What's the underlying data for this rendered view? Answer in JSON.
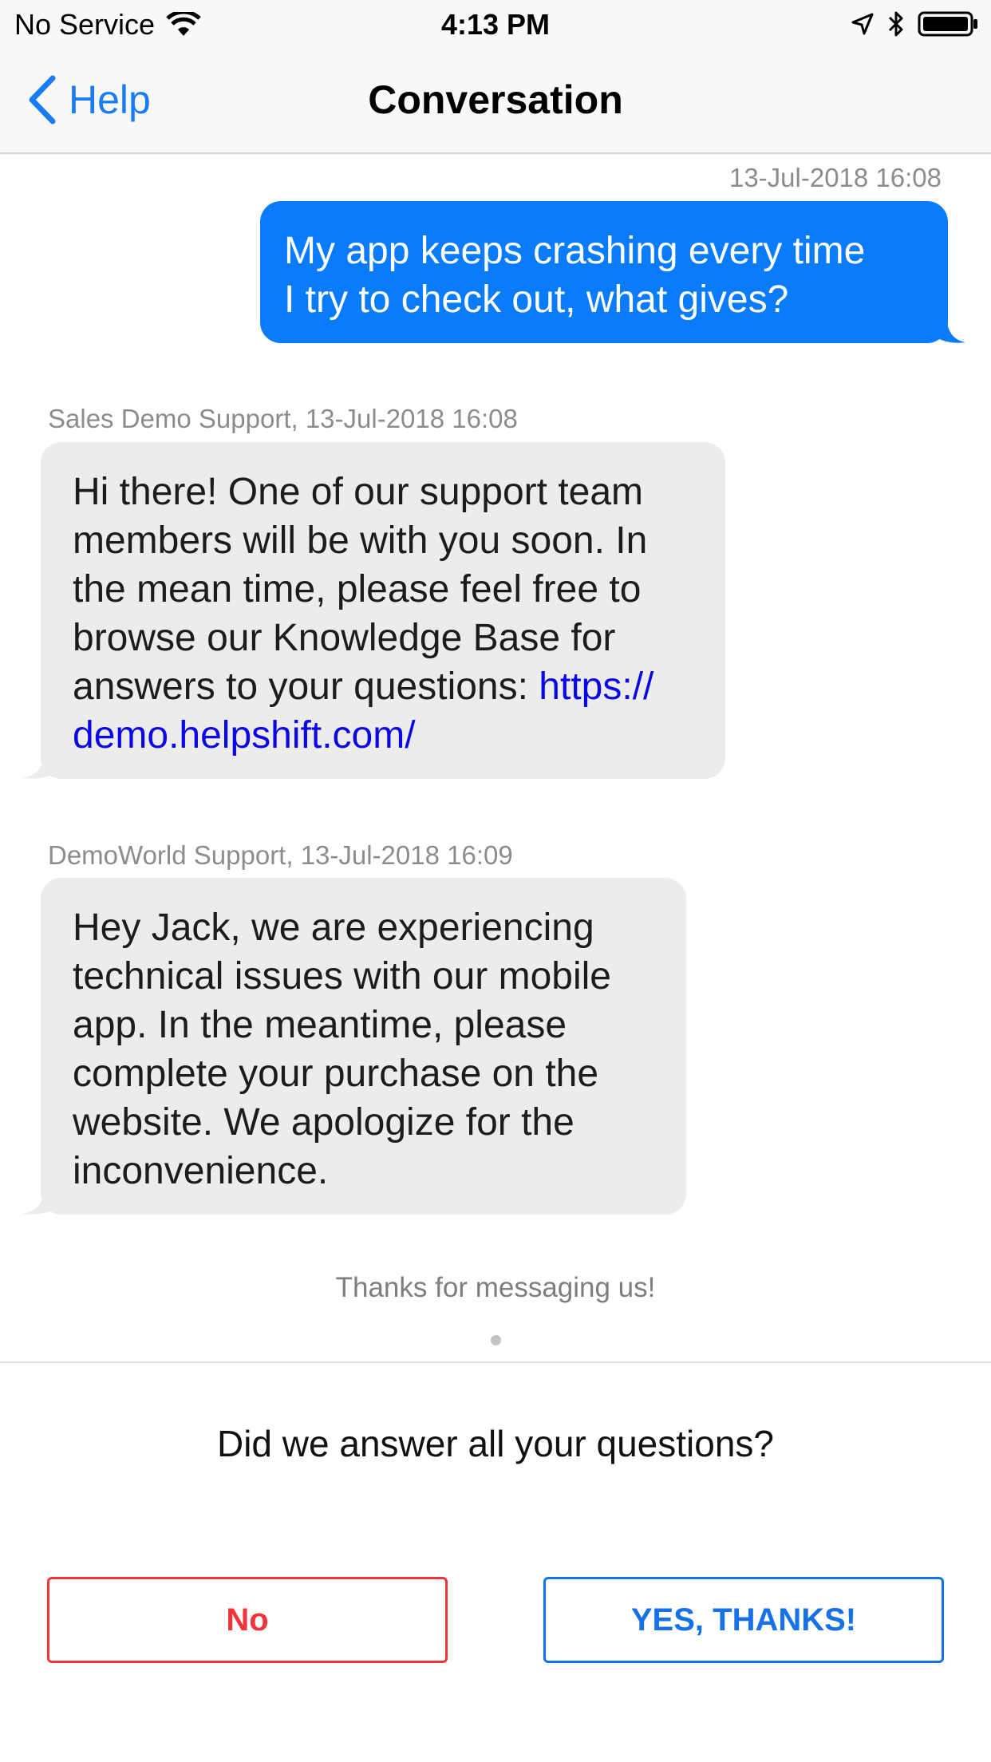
{
  "status_bar": {
    "carrier": "No Service",
    "time": "4:13 PM"
  },
  "nav": {
    "back_label": "Help",
    "title": "Conversation"
  },
  "messages": [
    {
      "timestamp": "13-Jul-2018 16:08",
      "lines": [
        "My app keeps crashing every time",
        "I try to check out, what gives?"
      ]
    },
    {
      "sender": "Sales Demo Support, 13-Jul-2018 16:08",
      "lines": [
        "Hi there! One of our support team",
        "members will be with you soon. In",
        "the mean time, please feel free to",
        "browse our Knowledge Base for",
        "answers to your questions: "
      ],
      "link_part1": "https://",
      "link_part2": "demo.helpshift.com/"
    },
    {
      "sender": "DemoWorld Support, 13-Jul-2018 16:09",
      "lines": [
        "Hey Jack, we are experiencing",
        "technical issues with our mobile",
        "app. In the meantime, please",
        "complete your purchase on the",
        "website. We apologize for the",
        "inconvenience."
      ]
    }
  ],
  "closing_note": "Thanks for messaging us!",
  "feedback": {
    "question": "Did we answer all your questions?",
    "no_label": "No",
    "yes_label": "YES, THANKS!"
  },
  "colors": {
    "accent": "#1a7cf5",
    "user_bubble": "#0a7bfb",
    "agent_bubble": "#ececec",
    "link": "#0b06e6",
    "no_button": "#f1343b",
    "yes_button": "#1672e6"
  }
}
